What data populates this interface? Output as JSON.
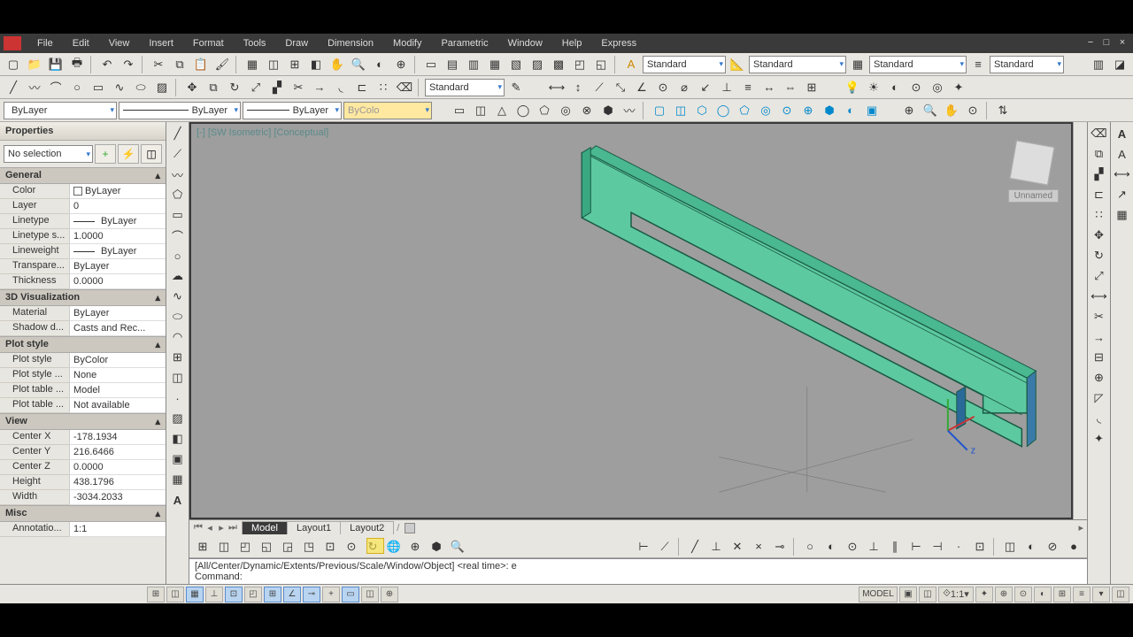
{
  "menu": {
    "items": [
      "File",
      "Edit",
      "View",
      "Insert",
      "Format",
      "Tools",
      "Draw",
      "Dimension",
      "Modify",
      "Parametric",
      "Window",
      "Help",
      "Express"
    ]
  },
  "styles": {
    "text": "Standard",
    "dim": "Standard",
    "table": "Standard",
    "ml": "Standard",
    "line": "Standard"
  },
  "layer": {
    "current": "ByLayer",
    "lt": "ByLayer",
    "lw": "ByLayer",
    "color": "ByColo"
  },
  "properties": {
    "title": "Properties",
    "sel": "No selection",
    "general": {
      "label": "General",
      "rows": [
        {
          "k": "Color",
          "v": "ByLayer",
          "swatch": true
        },
        {
          "k": "Layer",
          "v": "0"
        },
        {
          "k": "Linetype",
          "v": "ByLayer",
          "line": true
        },
        {
          "k": "Linetype s...",
          "v": "1.0000"
        },
        {
          "k": "Lineweight",
          "v": "ByLayer",
          "line": true
        },
        {
          "k": "Transpare...",
          "v": "ByLayer"
        },
        {
          "k": "Thickness",
          "v": "0.0000"
        }
      ]
    },
    "viz": {
      "label": "3D Visualization",
      "rows": [
        {
          "k": "Material",
          "v": "ByLayer"
        },
        {
          "k": "Shadow d...",
          "v": "Casts and Rec..."
        }
      ]
    },
    "plot": {
      "label": "Plot style",
      "rows": [
        {
          "k": "Plot style",
          "v": "ByColor"
        },
        {
          "k": "Plot style ...",
          "v": "None"
        },
        {
          "k": "Plot table ...",
          "v": "Model"
        },
        {
          "k": "Plot table ...",
          "v": "Not available"
        }
      ]
    },
    "view": {
      "label": "View",
      "rows": [
        {
          "k": "Center X",
          "v": "-178.1934"
        },
        {
          "k": "Center Y",
          "v": "216.6466"
        },
        {
          "k": "Center Z",
          "v": "0.0000"
        },
        {
          "k": "Height",
          "v": "438.1796"
        },
        {
          "k": "Width",
          "v": "-3034.2033"
        }
      ]
    },
    "misc": {
      "label": "Misc",
      "rows": [
        {
          "k": "Annotatio...",
          "v": "1:1"
        }
      ]
    }
  },
  "viewport": {
    "label": "[-] [SW Isometric] [Conceptual]",
    "cube": "Unnamed"
  },
  "tabs": {
    "items": [
      "Model",
      "Layout1",
      "Layout2"
    ],
    "active": 0
  },
  "cmd": {
    "line1": "[All/Center/Dynamic/Extents/Previous/Scale/Window/Object] <real time>: e",
    "line2": "Command:"
  },
  "status": {
    "model": "MODEL",
    "scale": "1:1"
  }
}
